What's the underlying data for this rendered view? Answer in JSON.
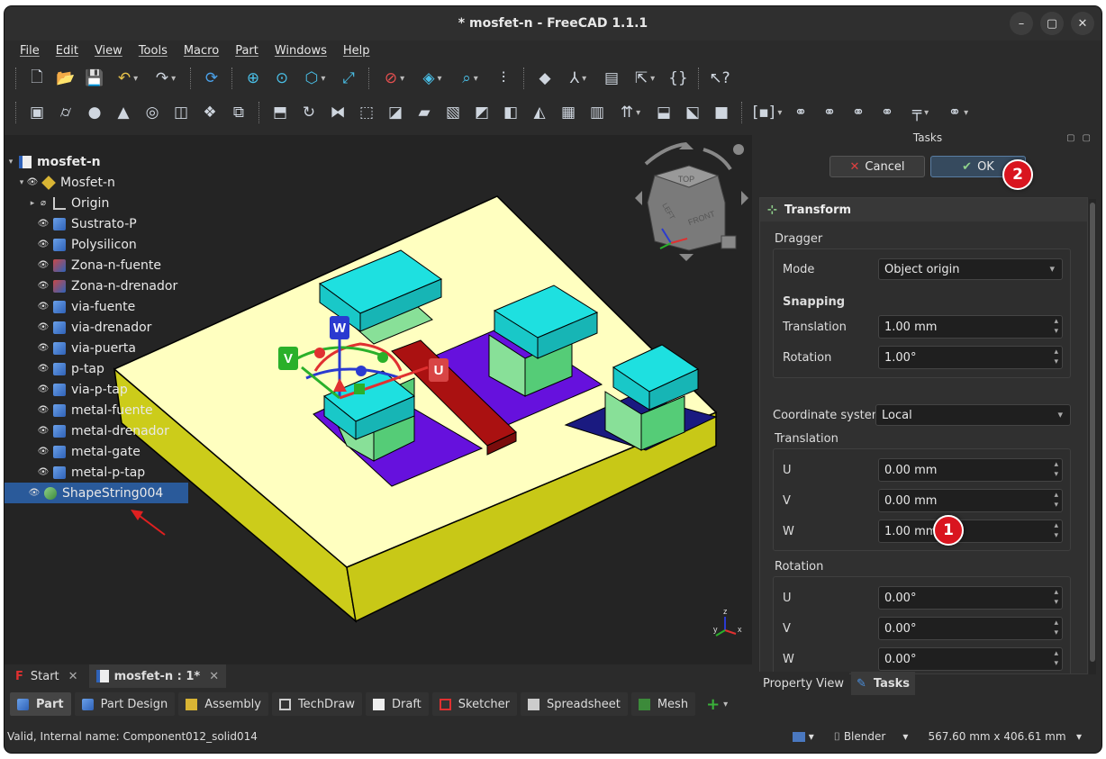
{
  "window": {
    "title": "* mosfet-n - FreeCAD 1.1.1"
  },
  "menu": [
    "File",
    "Edit",
    "View",
    "Tools",
    "Macro",
    "Part",
    "Windows",
    "Help"
  ],
  "toolbar1": [
    "new-file-icon",
    "open-file-icon",
    "save-icon",
    "undo-icon",
    "redo-icon",
    "refresh-icon",
    "fit-all-icon",
    "fit-selection-icon",
    "view-isometric-icon",
    "measure-icon",
    "draw-style-icon",
    "std-views-icon",
    "zoom-icon",
    "clipping-icon",
    "part-icon",
    "axis-icon",
    "group-icon",
    "link-icon",
    "macro-icon",
    "whats-this-icon"
  ],
  "toolbar2": [
    "box-icon",
    "cylinder-icon",
    "sphere-icon",
    "cone-icon",
    "torus-icon",
    "tube-icon",
    "primitives-icon",
    "shape-builder-icon",
    "extrude-icon",
    "revolve-icon",
    "mirror-icon",
    "fillet-icon",
    "chamfer-icon",
    "make-face-icon",
    "ruled-surface-icon",
    "loft-icon",
    "sweep-icon",
    "section-icon",
    "cross-sections-icon",
    "offset-icon",
    "thickness-icon",
    "projection-icon",
    "compound-icon",
    "check-geometry-icon",
    "defeaturing-icon",
    "boolean-icon",
    "cut-icon",
    "fuse-icon",
    "common-icon",
    "join-icon",
    "split-icon"
  ],
  "tree": {
    "document": "mosfet-n",
    "part": "Mosfet-n",
    "origin": "Origin",
    "items": [
      "Sustrato-P",
      "Polysilicon",
      "Zona-n-fuente",
      "Zona-n-drenador",
      "via-fuente",
      "via-drenador",
      "via-puerta",
      "p-tap",
      "via-p-tap",
      "metal-fuente",
      "metal-drenador",
      "metal-gate",
      "metal-p-tap"
    ],
    "selected": "ShapeString004"
  },
  "gizmo": {
    "w": "W",
    "v": "V",
    "u": "U"
  },
  "navcube": {
    "top": "TOP",
    "front": "FRONT",
    "left": "LEFT"
  },
  "axis_triad": {
    "z": "z",
    "y": "y",
    "x": "x"
  },
  "doc_tabs": [
    {
      "label": "Start"
    },
    {
      "label": "mosfet-n : 1*"
    }
  ],
  "workbenches": [
    "Part",
    "Part Design",
    "Assembly",
    "TechDraw",
    "Draft",
    "Sketcher",
    "Spreadsheet",
    "Mesh"
  ],
  "status": {
    "text": "Valid, Internal name: Component012_solid014",
    "nav_style": "Blender",
    "dimensions": "567.60 mm x 406.61 mm"
  },
  "tasks": {
    "title": "Tasks",
    "cancel": "Cancel",
    "ok": "OK",
    "panel_title": "Transform",
    "dragger_label": "Dragger",
    "mode_label": "Mode",
    "mode_value": "Object origin",
    "snapping_label": "Snapping",
    "snap_translation_label": "Translation",
    "snap_translation_value": "1.00 mm",
    "snap_rotation_label": "Rotation",
    "snap_rotation_value": "1.00°",
    "coord_label": "Coordinate system",
    "coord_value": "Local",
    "translation_label": "Translation",
    "t_u_label": "U",
    "t_u": "0.00 mm",
    "t_v_label": "V",
    "t_v": "0.00 mm",
    "t_w_label": "W",
    "t_w": "1.00 mm",
    "rotation_label": "Rotation",
    "r_u_label": "U",
    "r_u": "0.00°",
    "r_v_label": "V",
    "r_v": "0.00°",
    "r_w_label": "W",
    "r_w": "0.00°"
  },
  "panel_tabs": [
    "Property View",
    "Tasks"
  ],
  "badges": [
    "1",
    "2"
  ],
  "colors": {
    "accent": "#2a5a9a",
    "badge": "#d9151f",
    "substrate_top": "#ffffc0",
    "substrate_side": "#cccc1a",
    "metal": "#1ee0e0",
    "via": "#55cc77",
    "poly": "#aa1111",
    "nwell": "#6611dd",
    "ptap": "#1a1a80"
  }
}
